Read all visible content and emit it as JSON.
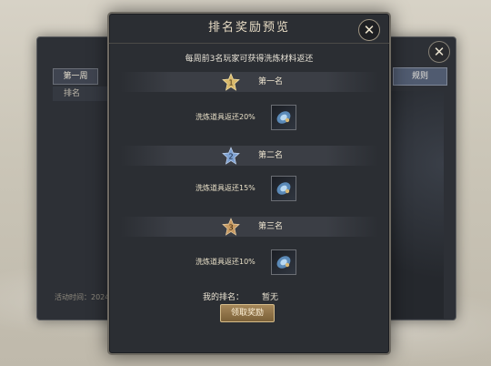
{
  "background": {
    "tab_label": "第一周",
    "table_header": "排名",
    "rules_label": "规则",
    "activity_time_label": "活动时间：2024"
  },
  "modal": {
    "title": "排名奖励预览",
    "subtitle": "每周前3名玩家可获得洗炼材料返还",
    "ranks": [
      {
        "badge": "1",
        "label": "第一名",
        "reward_text": "洗炼道具返还20%",
        "badge_color": "#d8b86a"
      },
      {
        "badge": "2",
        "label": "第二名",
        "reward_text": "洗炼道具返还15%",
        "badge_color": "#7ea1d1"
      },
      {
        "badge": "3",
        "label": "第三名",
        "reward_text": "洗炼道具返还10%",
        "badge_color": "#c79a62"
      }
    ],
    "my_rank_label": "我的排名：",
    "my_rank_value": "暂无",
    "claim_button": "领取奖励"
  },
  "icons": {
    "close": "close-icon",
    "item": "refine-item-icon"
  }
}
